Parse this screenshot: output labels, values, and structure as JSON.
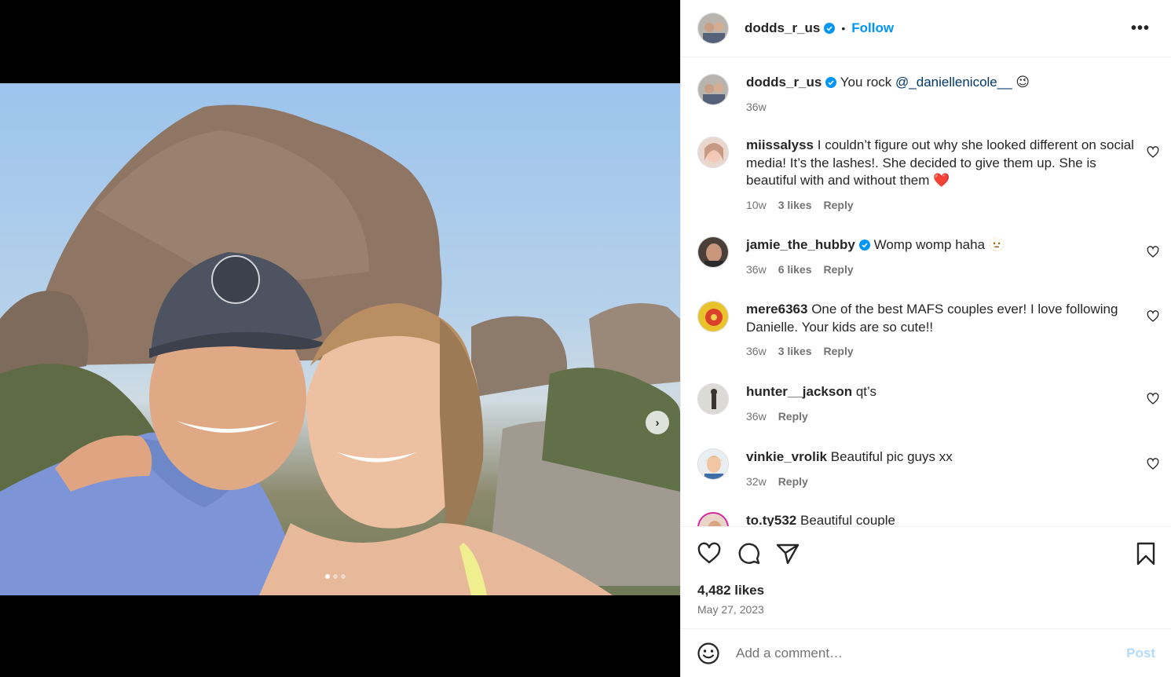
{
  "post": {
    "carousel_slides": 3,
    "active_slide": 1,
    "next_icon": "chevron-right"
  },
  "header": {
    "username": "dodds_r_us",
    "separator": "•",
    "follow_label": "Follow",
    "more_icon": "•••"
  },
  "caption": {
    "username": "dodds_r_us",
    "text": "You rock ",
    "mention": "@_daniellenicole__",
    "emoji": "😉",
    "age": "36w"
  },
  "comments": [
    {
      "username": "miissalyss",
      "text": "I couldn’t figure out why she looked different on social media! It’s the lashes!. She decided to give them up. She is beautiful with and without them ",
      "emoji": "❤️",
      "age": "10w",
      "likes": "3 likes",
      "reply": "Reply"
    },
    {
      "username": "jamie_the_hubby",
      "verified": true,
      "text": "Womp womp haha ",
      "emoji": "🫥",
      "age": "36w",
      "likes": "6 likes",
      "reply": "Reply"
    },
    {
      "username": "mere6363",
      "text": "One of the best MAFS couples ever! I love following Danielle. Your kids are so cute!!",
      "age": "36w",
      "likes": "3 likes",
      "reply": "Reply"
    },
    {
      "username": "hunter__jackson",
      "text": "qt’s",
      "age": "36w",
      "reply": "Reply"
    },
    {
      "username": "vinkie_vrolik",
      "text": "Beautiful pic guys xx",
      "age": "32w",
      "reply": "Reply"
    },
    {
      "username": "to.ty532",
      "text": "Beautiful couple"
    }
  ],
  "actions": {
    "like_icon": "heart-outline",
    "comment_icon": "speech-bubble",
    "share_icon": "paper-plane",
    "save_icon": "bookmark"
  },
  "likes": "4,482 likes",
  "date": "May 27, 2023",
  "add_comment": {
    "placeholder": "Add a comment…",
    "post_label": "Post",
    "emoji_icon": "smiley-face"
  },
  "colors": {
    "accent": "#0095f6",
    "mention": "#00376b",
    "secondary_text": "#737373",
    "heart": "#e0245e",
    "post_disabled": "#b3dbff"
  }
}
